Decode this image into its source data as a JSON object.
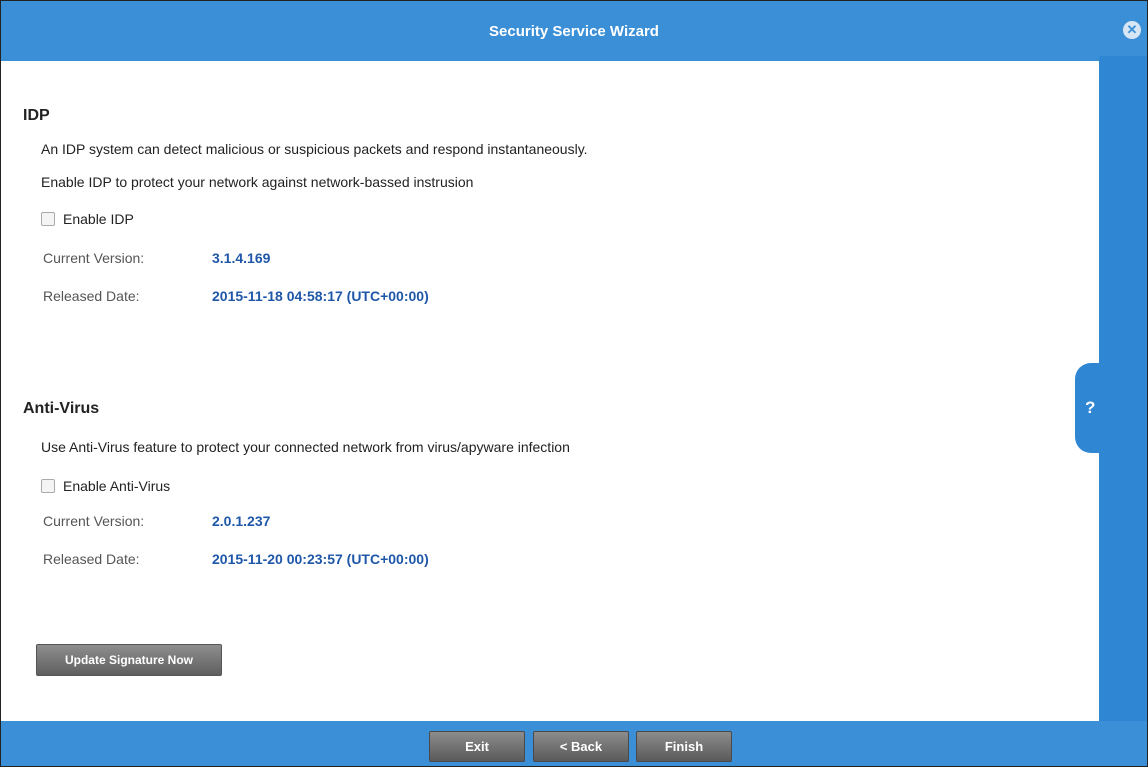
{
  "window": {
    "title": "Security Service Wizard",
    "close_icon": "close-icon"
  },
  "help": {
    "label": "?"
  },
  "idp": {
    "title": "IDP",
    "desc1": "An IDP system can detect malicious or suspicious packets and respond instantaneously.",
    "desc2": "Enable IDP to protect your network against network-bassed instrusion",
    "enable_label": "Enable IDP",
    "enabled": false,
    "version_label": "Current Version:",
    "version_value": "3.1.4.169",
    "date_label": "Released Date:",
    "date_value": "2015-11-18 04:58:17 (UTC+00:00)"
  },
  "antivirus": {
    "title": "Anti-Virus",
    "desc1": "Use Anti-Virus feature to protect your connected network from virus/apyware infection",
    "enable_label": "Enable Anti-Virus",
    "enabled": false,
    "version_label": "Current Version:",
    "version_value": "2.0.1.237",
    "date_label": "Released Date:",
    "date_value": "2015-11-20 00:23:57 (UTC+00:00)"
  },
  "actions": {
    "update_label": "Update Signature Now",
    "exit_label": "Exit",
    "back_label": "< Back",
    "finish_label": "Finish"
  },
  "colors": {
    "header": "#3a8fd6",
    "sidebar": "#2f86d3",
    "value": "#1f57a8"
  }
}
